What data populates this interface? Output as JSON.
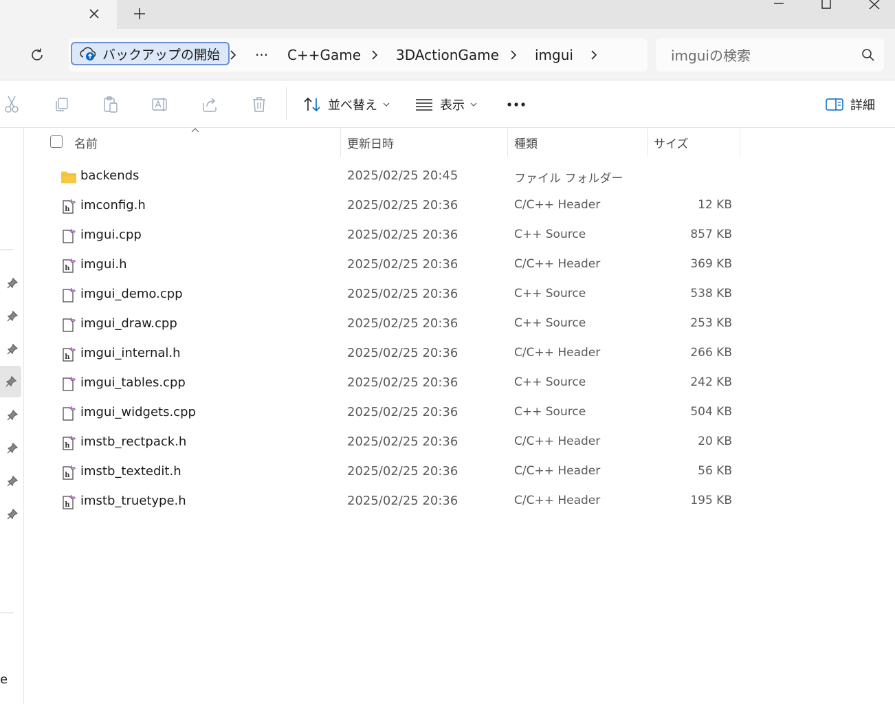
{
  "window": {
    "tab_close_glyph": "✕",
    "new_tab_glyph": "+",
    "minimize_glyph": "—",
    "maximize_glyph": "☐",
    "close_glyph": "✕"
  },
  "breadcrumb": {
    "home_label": "バックアップの開始",
    "overflow": "···",
    "items": [
      "C++Game",
      "3DActionGame",
      "imgui"
    ]
  },
  "search": {
    "placeholder": "imguiの検索"
  },
  "command_bar": {
    "sort_label": "並べ替え",
    "view_label": "表示",
    "more_glyph": "•••",
    "details_label": "詳細"
  },
  "columns": {
    "name": "名前",
    "date": "更新日時",
    "type": "種類",
    "size": "サイズ"
  },
  "files": [
    {
      "name": "backends",
      "date": "2025/02/25 20:45",
      "type": "ファイル フォルダー",
      "size": "",
      "icon": "folder-icon"
    },
    {
      "name": "imconfig.h",
      "date": "2025/02/25 20:36",
      "type": "C/C++ Header",
      "size": "12 KB",
      "icon": "header-file-icon"
    },
    {
      "name": "imgui.cpp",
      "date": "2025/02/25 20:36",
      "type": "C++ Source",
      "size": "857 KB",
      "icon": "source-file-icon"
    },
    {
      "name": "imgui.h",
      "date": "2025/02/25 20:36",
      "type": "C/C++ Header",
      "size": "369 KB",
      "icon": "header-file-icon"
    },
    {
      "name": "imgui_demo.cpp",
      "date": "2025/02/25 20:36",
      "type": "C++ Source",
      "size": "538 KB",
      "icon": "source-file-icon"
    },
    {
      "name": "imgui_draw.cpp",
      "date": "2025/02/25 20:36",
      "type": "C++ Source",
      "size": "253 KB",
      "icon": "source-file-icon"
    },
    {
      "name": "imgui_internal.h",
      "date": "2025/02/25 20:36",
      "type": "C/C++ Header",
      "size": "266 KB",
      "icon": "header-file-icon"
    },
    {
      "name": "imgui_tables.cpp",
      "date": "2025/02/25 20:36",
      "type": "C++ Source",
      "size": "242 KB",
      "icon": "source-file-icon"
    },
    {
      "name": "imgui_widgets.cpp",
      "date": "2025/02/25 20:36",
      "type": "C++ Source",
      "size": "504 KB",
      "icon": "source-file-icon"
    },
    {
      "name": "imstb_rectpack.h",
      "date": "2025/02/25 20:36",
      "type": "C/C++ Header",
      "size": "20 KB",
      "icon": "header-file-icon"
    },
    {
      "name": "imstb_textedit.h",
      "date": "2025/02/25 20:36",
      "type": "C/C++ Header",
      "size": "56 KB",
      "icon": "header-file-icon"
    },
    {
      "name": "imstb_truetype.h",
      "date": "2025/02/25 20:36",
      "type": "C/C++ Header",
      "size": "195 KB",
      "icon": "header-file-icon"
    }
  ],
  "nav_pane": {
    "truncated_text": "e"
  },
  "colors": {
    "accent": "#0067c0",
    "folder": "#f8c843",
    "file_badge": "#b05cc8"
  }
}
